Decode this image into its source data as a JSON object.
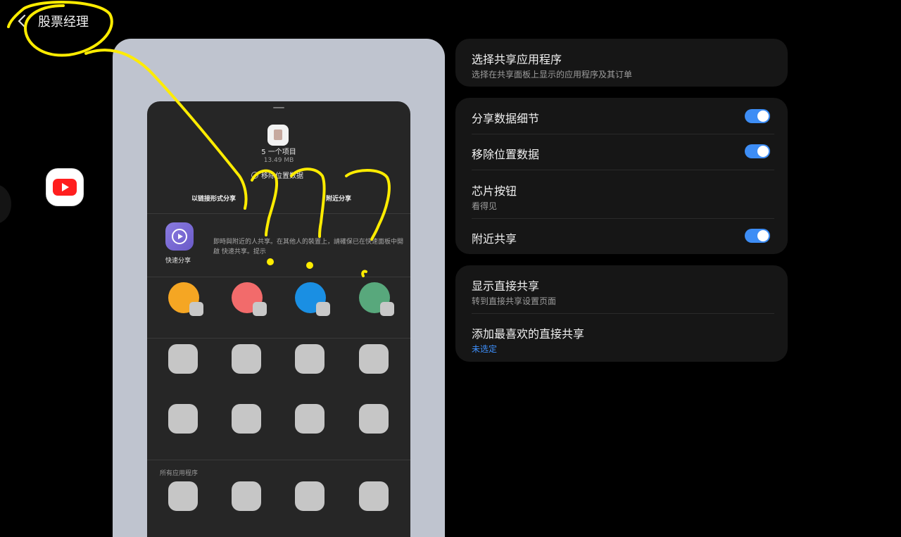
{
  "header": {
    "title": "股票经理",
    "back_icon": "chevron-left-icon"
  },
  "floating_app": {
    "icon": "youtube-icon",
    "color": "#ff1e1e"
  },
  "preview": {
    "item_count": "5 一个项目",
    "file_size": "13.49 MB",
    "remove_location_label": "移除位置数据",
    "share_as_link": "以链接形式分享",
    "nearby_share": "附近分享",
    "quick_share_label": "快速分享",
    "quick_share_desc": "即時與附近的人共享。在其他人的裝置上，請確保已在快速面板中開啟 快速共享。提示",
    "all_apps_label": "所有应用程序",
    "contact_colors": [
      "#f5a623",
      "#f26b6b",
      "#1a8fe3",
      "#58a87c"
    ]
  },
  "settings": {
    "choose_apps": {
      "title": "选择共享应用程序",
      "subtitle": "选择在共享面板上显示的应用程序及其订单"
    },
    "share_data_details": {
      "title": "分享数据细节",
      "enabled": true
    },
    "remove_location": {
      "title": "移除位置数据",
      "enabled": true
    },
    "chip_button": {
      "title": "芯片按钮",
      "subtitle": "看得见"
    },
    "nearby_share": {
      "title": "附近共享",
      "enabled": true
    },
    "show_direct_share": {
      "title": "显示直接共享",
      "subtitle": "转到直接共享设置页面"
    },
    "add_favorite_direct_share": {
      "title": "添加最喜欢的直接共享",
      "subtitle": "未选定"
    }
  },
  "colors": {
    "accent": "#3d8df5",
    "annotation": "#ffec00",
    "card": "#161616"
  }
}
